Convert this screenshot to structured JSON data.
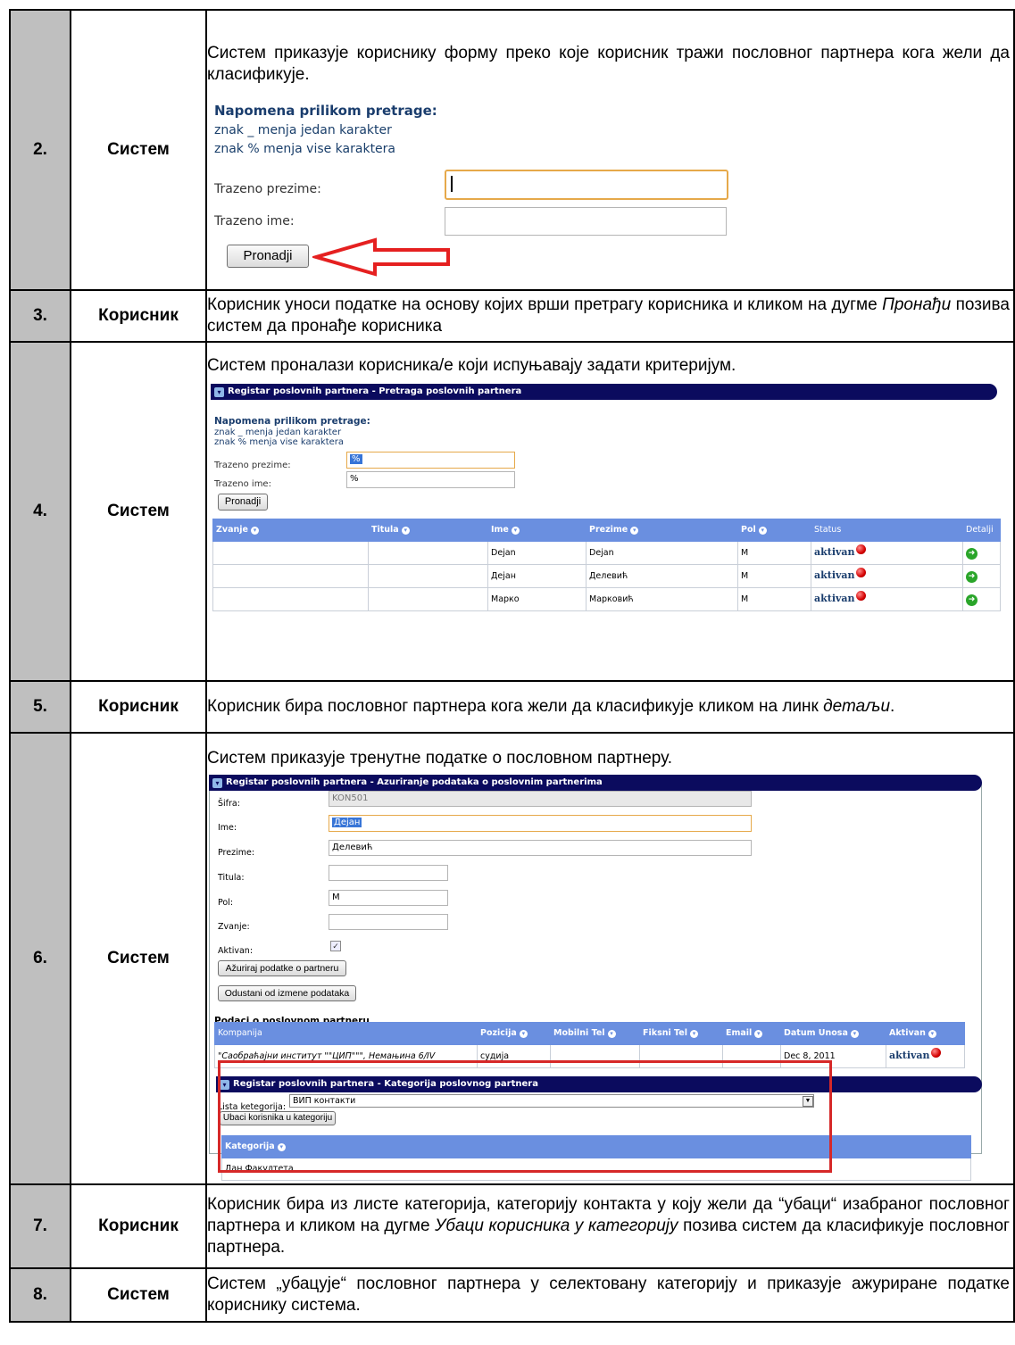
{
  "rows": [
    {
      "num": "2.",
      "actor": "Систем",
      "desc": "Систем приказује кориснику форму преко које корисник тражи пословног партнера кога жели да класификује."
    },
    {
      "num": "3.",
      "actor": "Корисник",
      "desc_parts": [
        "Корисник уноси податке на основу којих врши претрагу корисника и кликом на дугме ",
        "Пронађи",
        " позива систем да пронађе корисника"
      ]
    },
    {
      "num": "4.",
      "actor": "Систем",
      "desc": "Систем проналази корисника/е који испуњавају задати критеријум."
    },
    {
      "num": "5.",
      "actor": "Корисник",
      "desc_parts": [
        "Корисник бира пословног партнера кога жели да класификује кликом на линк ",
        "детаљи",
        "."
      ]
    },
    {
      "num": "6.",
      "actor": "Систем",
      "desc": "Систем приказује тренутне податке о пословном партнеру."
    },
    {
      "num": "7.",
      "actor": "Корисник",
      "desc_parts": [
        "Корисник бира из листе категорија, категорију контакта у коју жели да “убаци“ изабраног пословног партнера и кликом на дугме ",
        "Убаци корисника у категорију",
        " позива систем да класификује пословног партнера."
      ]
    },
    {
      "num": "8.",
      "actor": "Систем",
      "desc": "Систем „убацује“ пословног партнера у селектовану категорију и приказује ажуриране податке кориснику система."
    }
  ],
  "search_form": {
    "note_title": "Napomena prilikom pretrage:",
    "note_1": "znak _ menja jedan karakter",
    "note_2": "znak % menja vise karaktera",
    "surname_label": "Trazeno prezime:",
    "name_label": "Trazeno ime:",
    "search_button": "Pronadji"
  },
  "results_panel": {
    "header": "Registar poslovnih partnera - Pretraga poslovnih partnera",
    "surname_value": "%",
    "name_value": "%",
    "columns": [
      "Zvanje",
      "Titula",
      "Ime",
      "Prezime",
      "Pol",
      "Status",
      "Detalji"
    ],
    "rows": [
      {
        "ime": "Dejan",
        "prezime": "Dejan",
        "pol": "M",
        "status": "aktivan"
      },
      {
        "ime": "Дејан",
        "prezime": "Делевић",
        "pol": "M",
        "status": "aktivan"
      },
      {
        "ime": "Марко",
        "prezime": "Марковић",
        "pol": "M",
        "status": "aktivan"
      }
    ]
  },
  "edit_panel": {
    "header": "Registar poslovnih partnera - Azuriranje podataka o poslovnim partnerima",
    "labels": {
      "sifra": "Šifra:",
      "ime": "Ime:",
      "prezime": "Prezime:",
      "titula": "Titula:",
      "pol": "Pol:",
      "zvanje": "Zvanje:",
      "aktivan": "Aktivan:"
    },
    "values": {
      "sifra": "KON501",
      "ime": "Дејан",
      "prezime": "Делевић",
      "titula": "",
      "pol": "M",
      "zvanje": ""
    },
    "update_button": "Ažuriraj podatke o partneru",
    "cancel_button": "Odustani od izmene podataka",
    "section_title": "Podaci o poslovnom partneru",
    "columns": [
      "Kompanija",
      "Pozicija",
      "Mobilni Tel",
      "Fiksni Tel",
      "Email",
      "Datum Unosa",
      "Aktivan"
    ],
    "row": {
      "kompanija": "\"Саобраћајни институт \"\"ЦИП\"\"\", Немањина 6/IV",
      "pozicija": "судија",
      "mobilni": "",
      "fiksni": "",
      "email": "",
      "datum": "Dec 8, 2011",
      "aktivan": "aktivan"
    }
  },
  "category_panel": {
    "header": "Registar poslovnih partnera - Kategorija poslovnog partnera",
    "list_label": "Lista ketegorija:",
    "list_value": "ВИП контакти",
    "insert_button": "Ubaci korisnika u kategoriju",
    "column": "Kategorija",
    "row": "Дан Факултета"
  }
}
